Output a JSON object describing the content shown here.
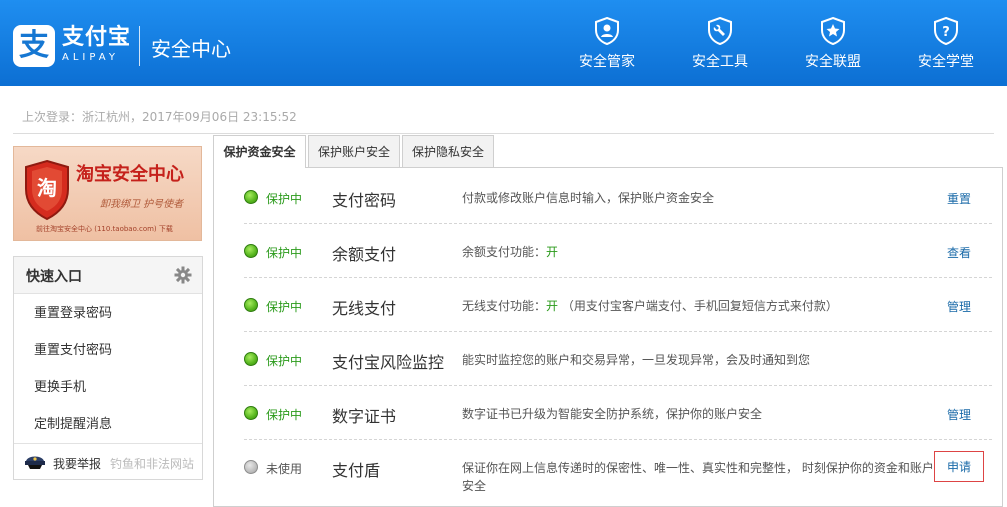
{
  "header": {
    "logo_glyph": "支",
    "logo_name": "支付宝",
    "logo_sub": "ALIPAY",
    "title": "安全中心",
    "nav": [
      {
        "label": "安全管家",
        "icon": "shield-user-icon"
      },
      {
        "label": "安全工具",
        "icon": "shield-wrench-icon"
      },
      {
        "label": "安全联盟",
        "icon": "shield-star-icon"
      },
      {
        "label": "安全学堂",
        "icon": "shield-question-icon"
      }
    ]
  },
  "last_login": "上次登录：浙江杭州，2017年09月06日 23:15:52",
  "banner": {
    "title": "淘宝安全中心",
    "slogan": "卸我绑卫  护号使者",
    "footer": "前往淘宝安全中心 (110.taobao.com) 下载",
    "logo_glyph": "淘"
  },
  "quick": {
    "title": "快速入口",
    "links": [
      "重置登录密码",
      "重置支付密码",
      "更换手机",
      "定制提醒消息"
    ],
    "report_label": "我要举报",
    "report_sub": "钓鱼和非法网站"
  },
  "tabs": [
    "保护资金安全",
    "保护账户安全",
    "保护隐私安全"
  ],
  "rows": [
    {
      "status": "保护中",
      "feature": "支付密码",
      "desc": "付款或修改账户信息时输入，保护账户资金安全",
      "action": "重置"
    },
    {
      "status": "保护中",
      "feature": "余额支付",
      "desc_prefix": "余额支付功能：",
      "desc_on": "开",
      "desc_suffix": "",
      "action": "查看"
    },
    {
      "status": "保护中",
      "feature": "无线支付",
      "desc_prefix": "无线支付功能：",
      "desc_on": "开",
      "desc_suffix": " （用支付宝客户端支付、手机回复短信方式来付款）",
      "action": "管理"
    },
    {
      "status": "保护中",
      "feature": "支付宝风险监控",
      "desc": "能实时监控您的账户和交易异常，一旦发现异常，会及时通知到您",
      "action": ""
    },
    {
      "status": "保护中",
      "feature": "数字证书",
      "desc": "数字证书已升级为智能安全防护系统，保护你的账户安全",
      "action": "管理"
    },
    {
      "status": "未使用",
      "feature": "支付盾",
      "desc": "保证你在网上信息传递时的保密性、唯一性、真实性和完整性， 时刻保护你的资金和账户安全",
      "action": "申请"
    }
  ],
  "colors": {
    "header_blue": "#1677d2",
    "status_green": "#2a9a1a",
    "link_blue": "#1a6aa8",
    "highlight_red": "#dd4444"
  }
}
